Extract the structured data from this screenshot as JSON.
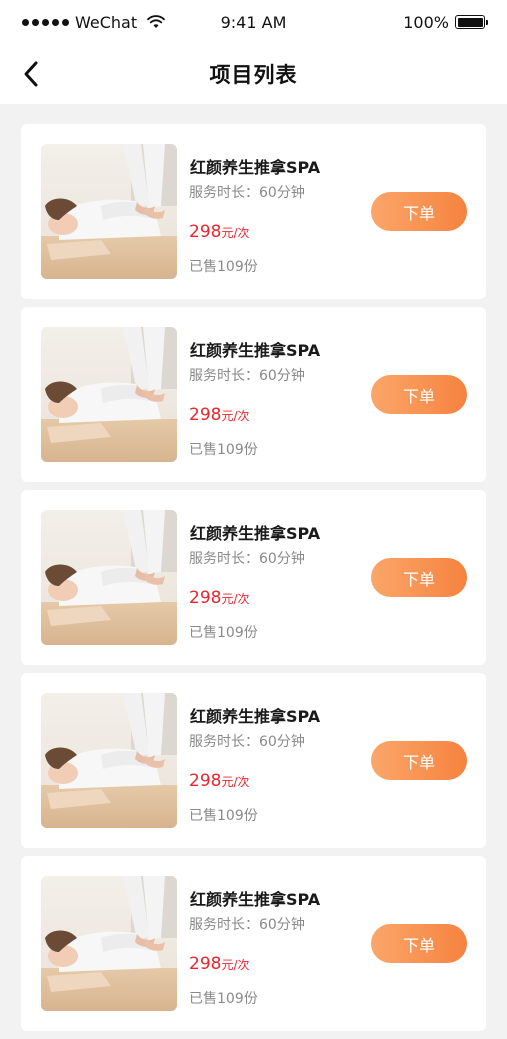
{
  "status_bar": {
    "carrier": "WeChat",
    "time": "9:41 AM",
    "battery": "100%"
  },
  "nav": {
    "title": "项目列表",
    "back_icon": "chevron-left-icon"
  },
  "items": [
    {
      "title": "红颜养生推拿SPA",
      "duration": "服务时长：60分钟",
      "price": "298",
      "price_unit": "元/次",
      "sold": "已售109份",
      "button": "下单"
    },
    {
      "title": "红颜养生推拿SPA",
      "duration": "服务时长：60分钟",
      "price": "298",
      "price_unit": "元/次",
      "sold": "已售109份",
      "button": "下单"
    },
    {
      "title": "红颜养生推拿SPA",
      "duration": "服务时长：60分钟",
      "price": "298",
      "price_unit": "元/次",
      "sold": "已售109份",
      "button": "下单"
    },
    {
      "title": "红颜养生推拿SPA",
      "duration": "服务时长：60分钟",
      "price": "298",
      "price_unit": "元/次",
      "sold": "已售109份",
      "button": "下单"
    },
    {
      "title": "红颜养生推拿SPA",
      "duration": "服务时长：60分钟",
      "price": "298",
      "price_unit": "元/次",
      "sold": "已售109份",
      "button": "下单"
    }
  ],
  "colors": {
    "price": "#e8262f",
    "button_start": "#fba66a",
    "button_end": "#f6833f",
    "background": "#f2f2f2"
  }
}
